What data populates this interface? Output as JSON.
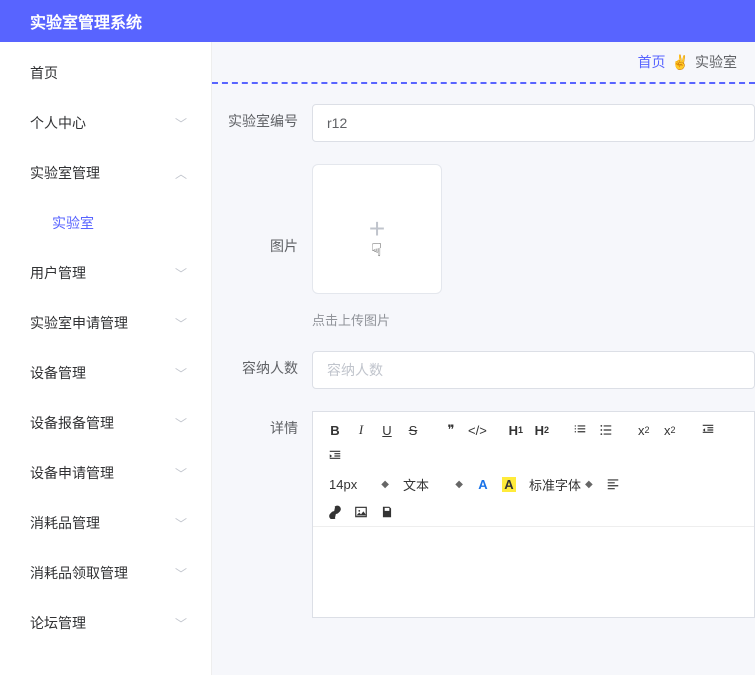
{
  "app": {
    "title": "实验室管理系统"
  },
  "sidebar": {
    "items": [
      {
        "label": "首页",
        "expandable": false
      },
      {
        "label": "个人中心",
        "expandable": true
      },
      {
        "label": "实验室管理",
        "expandable": true,
        "expanded": true,
        "children": [
          {
            "label": "实验室"
          }
        ]
      },
      {
        "label": "用户管理",
        "expandable": true
      },
      {
        "label": "实验室申请管理",
        "expandable": true
      },
      {
        "label": "设备管理",
        "expandable": true
      },
      {
        "label": "设备报备管理",
        "expandable": true
      },
      {
        "label": "设备申请管理",
        "expandable": true
      },
      {
        "label": "消耗品管理",
        "expandable": true
      },
      {
        "label": "消耗品领取管理",
        "expandable": true
      },
      {
        "label": "论坛管理",
        "expandable": true
      }
    ]
  },
  "breadcrumb": {
    "home": "首页",
    "sep_icon": "✌",
    "current": "实验室"
  },
  "form": {
    "lab_no": {
      "label": "实验室编号",
      "value": "r12"
    },
    "image": {
      "label": "图片",
      "hint": "点击上传图片"
    },
    "capacity": {
      "label": "容纳人数",
      "placeholder": "容纳人数",
      "value": ""
    },
    "detail": {
      "label": "详情"
    }
  },
  "editor": {
    "font_size": "14px",
    "block": "文本",
    "font_family": "标准字体",
    "btns": {
      "bold": "B",
      "italic": "I",
      "underline": "U",
      "strike": "S",
      "quote": "❞",
      "code": "</>",
      "h1": "H₁",
      "h2": "H₂",
      "ol": "list-ol",
      "ul": "list-ul",
      "sub": "x₂",
      "sup": "x²",
      "indent_dec": "indent-dec",
      "indent_inc": "indent-inc",
      "color": "A",
      "bgcolor": "A",
      "align": "align",
      "link": "link",
      "image": "image",
      "save": "save"
    }
  }
}
